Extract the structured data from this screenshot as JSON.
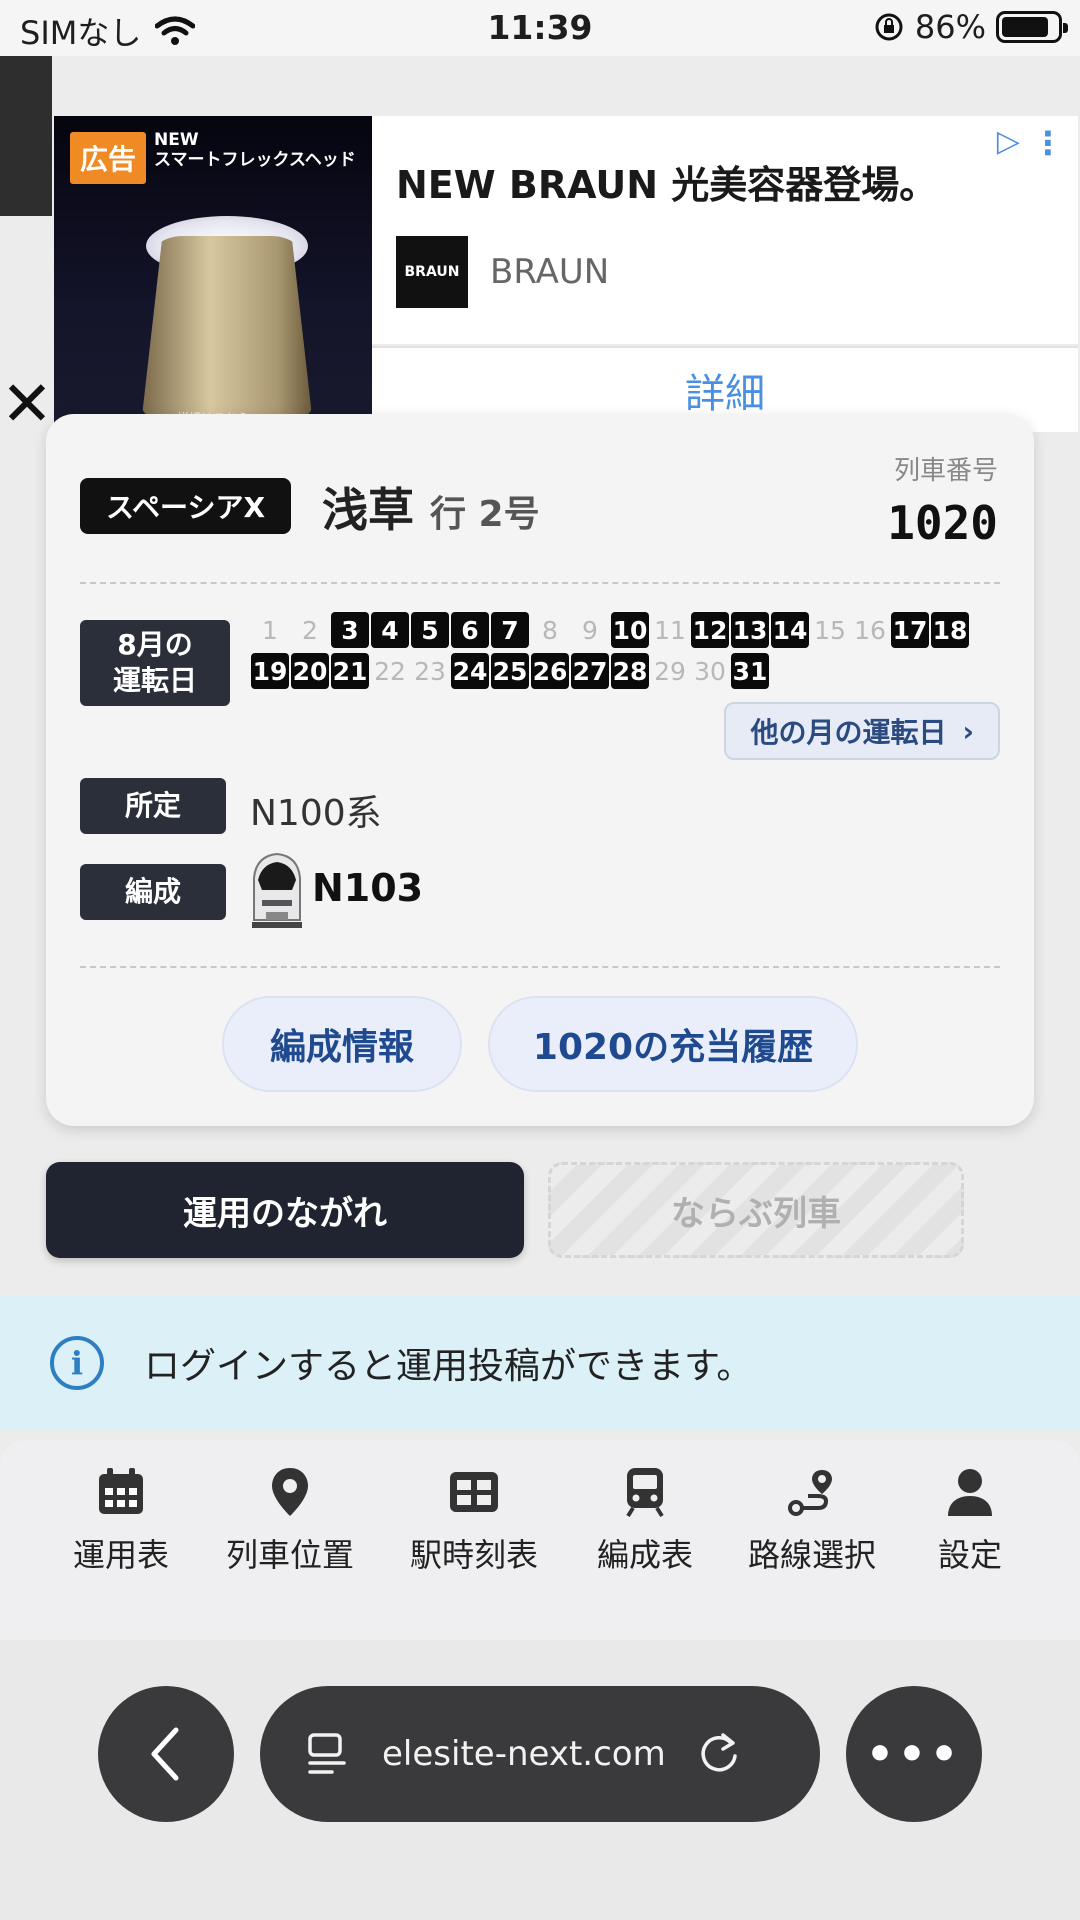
{
  "status_bar": {
    "carrier": "SIMなし",
    "time": "11:39",
    "battery_percent": "86%",
    "battery_level": 0.86
  },
  "ad": {
    "tag": "広告",
    "image_line1": "NEW",
    "image_line2": "スマートフレックスヘッド",
    "image_caption": "詳細はこちら",
    "headline": "NEW BRAUN 光美容器登場。",
    "brand_logo": "BRAUN",
    "brand": "BRAUN",
    "cta": "詳細",
    "close": "✕"
  },
  "train": {
    "type_badge": "スペーシアX",
    "destination": "浅草",
    "destination_suffix": "行 2号",
    "train_number_label": "列車番号",
    "train_number": "1020",
    "operating_days_label_line1": "8月の",
    "operating_days_label_line2": "運転日",
    "operating_days": [
      1,
      2,
      3,
      4,
      5,
      6,
      7,
      8,
      9,
      10,
      11,
      12,
      13,
      14,
      15,
      16,
      17,
      18,
      19,
      20,
      21,
      22,
      23,
      24,
      25,
      26,
      27,
      28,
      29,
      30,
      31
    ],
    "running_days": [
      3,
      4,
      5,
      6,
      7,
      10,
      12,
      13,
      14,
      17,
      18,
      19,
      20,
      21,
      24,
      25,
      26,
      27,
      28,
      31
    ],
    "other_month_button": "他の月の運転日",
    "assigned_label": "所定",
    "assigned_value": "N100系",
    "formation_label": "編成",
    "formation_value": "N103",
    "formation_info_button": "編成情報",
    "history_button": "1020の充当履歴"
  },
  "tabs": {
    "active": "運用のながれ",
    "inactive": "ならぶ列車"
  },
  "info": {
    "icon": "info-icon",
    "text": "ログインすると運用投稿ができます。"
  },
  "bottom_nav": [
    {
      "icon": "calendar-icon",
      "label": "運用表"
    },
    {
      "icon": "map-pin-icon",
      "label": "列車位置"
    },
    {
      "icon": "grid-table-icon",
      "label": "駅時刻表"
    },
    {
      "icon": "train-icon",
      "label": "編成表"
    },
    {
      "icon": "route-icon",
      "label": "路線選択"
    },
    {
      "icon": "user-icon",
      "label": "設定"
    }
  ],
  "browser": {
    "url": "elesite-next.com"
  }
}
